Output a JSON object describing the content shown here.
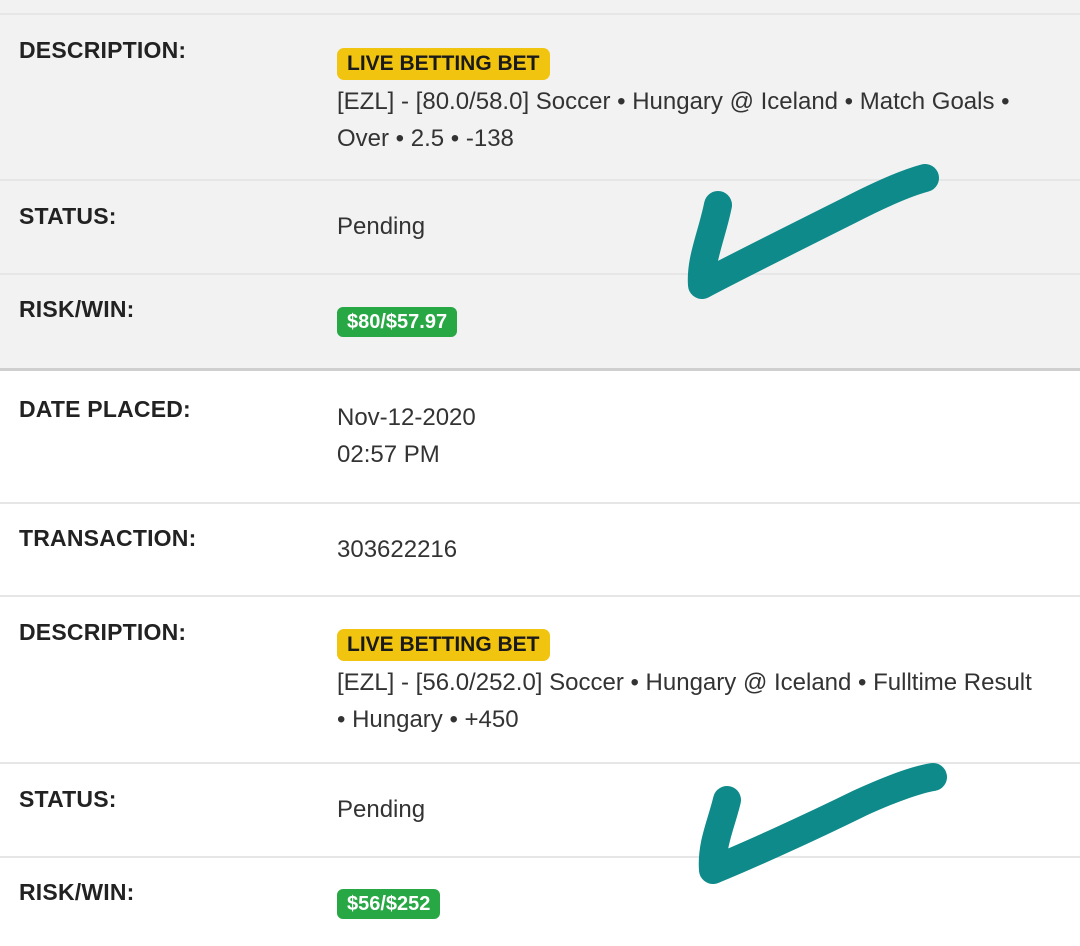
{
  "bet1": {
    "description_label": "DESCRIPTION:",
    "badge": "LIVE BETTING BET",
    "description_line1": "[EZL] - [80.0/58.0] Soccer • Hungary @ Iceland • Match Goals •",
    "description_line2": "Over • 2.5 • -138",
    "status_label": "STATUS:",
    "status_value": "Pending",
    "riskwin_label": "RISK/WIN:",
    "riskwin_value": "$80/$57.97"
  },
  "bet2": {
    "date_label": "DATE PLACED:",
    "date_value": "Nov-12-2020",
    "time_value": "02:57 PM",
    "transaction_label": "TRANSACTION:",
    "transaction_value": "303622216",
    "description_label": "DESCRIPTION:",
    "badge": "LIVE BETTING BET",
    "description_line1": "[EZL] - [56.0/252.0] Soccer • Hungary @ Iceland • Fulltime Result",
    "description_line2": "• Hungary • +450",
    "status_label": "STATUS:",
    "status_value": "Pending",
    "riskwin_label": "RISK/WIN:",
    "riskwin_value": "$56/$252"
  },
  "colors": {
    "badge_live": "#f1c40f",
    "badge_money": "#28a745",
    "checkmark": "#0e8a8a"
  },
  "icons": [
    "checkmark-icon",
    "checkmark-icon"
  ]
}
